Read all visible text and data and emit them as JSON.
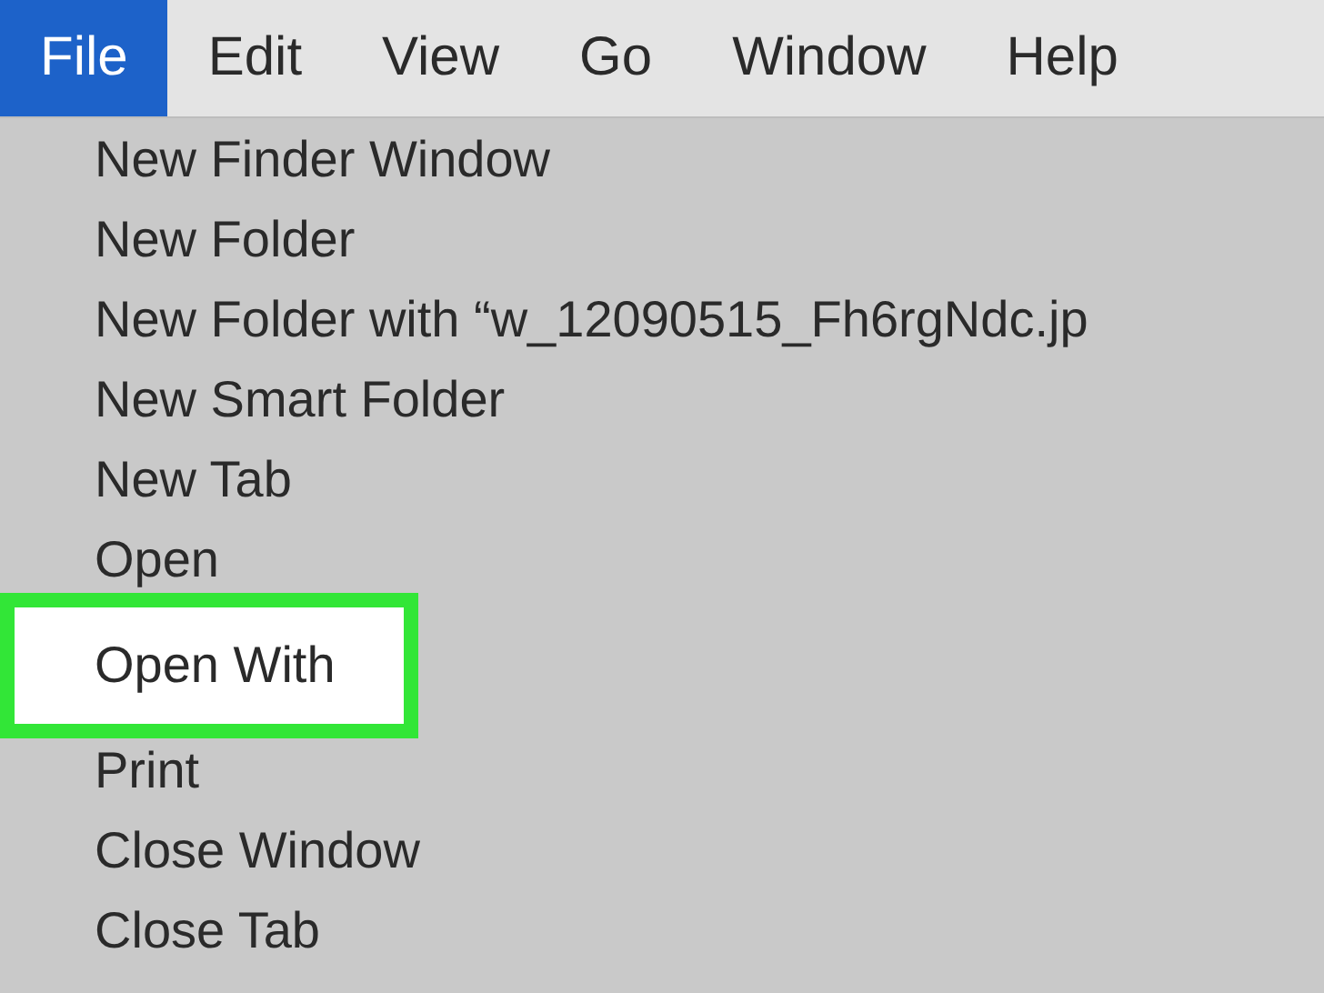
{
  "menu_bar": [
    {
      "label": "File",
      "selected": true
    },
    {
      "label": "Edit",
      "selected": false
    },
    {
      "label": "View",
      "selected": false
    },
    {
      "label": "Go",
      "selected": false
    },
    {
      "label": "Window",
      "selected": false
    },
    {
      "label": "Help",
      "selected": false
    }
  ],
  "menu": {
    "items": [
      {
        "label": "New Finder Window",
        "highlighted": false
      },
      {
        "label": "New Folder",
        "highlighted": false
      },
      {
        "label": "New Folder with “w_12090515_Fh6rgNdc.jp",
        "highlighted": false
      },
      {
        "label": "New Smart Folder",
        "highlighted": false
      },
      {
        "label": "New Tab",
        "highlighted": false
      },
      {
        "label": "Open",
        "highlighted": false
      },
      {
        "label": "Open With",
        "highlighted": true
      },
      {
        "label": "Print",
        "highlighted": false
      },
      {
        "label": "Close Window",
        "highlighted": false
      },
      {
        "label": "Close Tab",
        "highlighted": false
      }
    ]
  }
}
